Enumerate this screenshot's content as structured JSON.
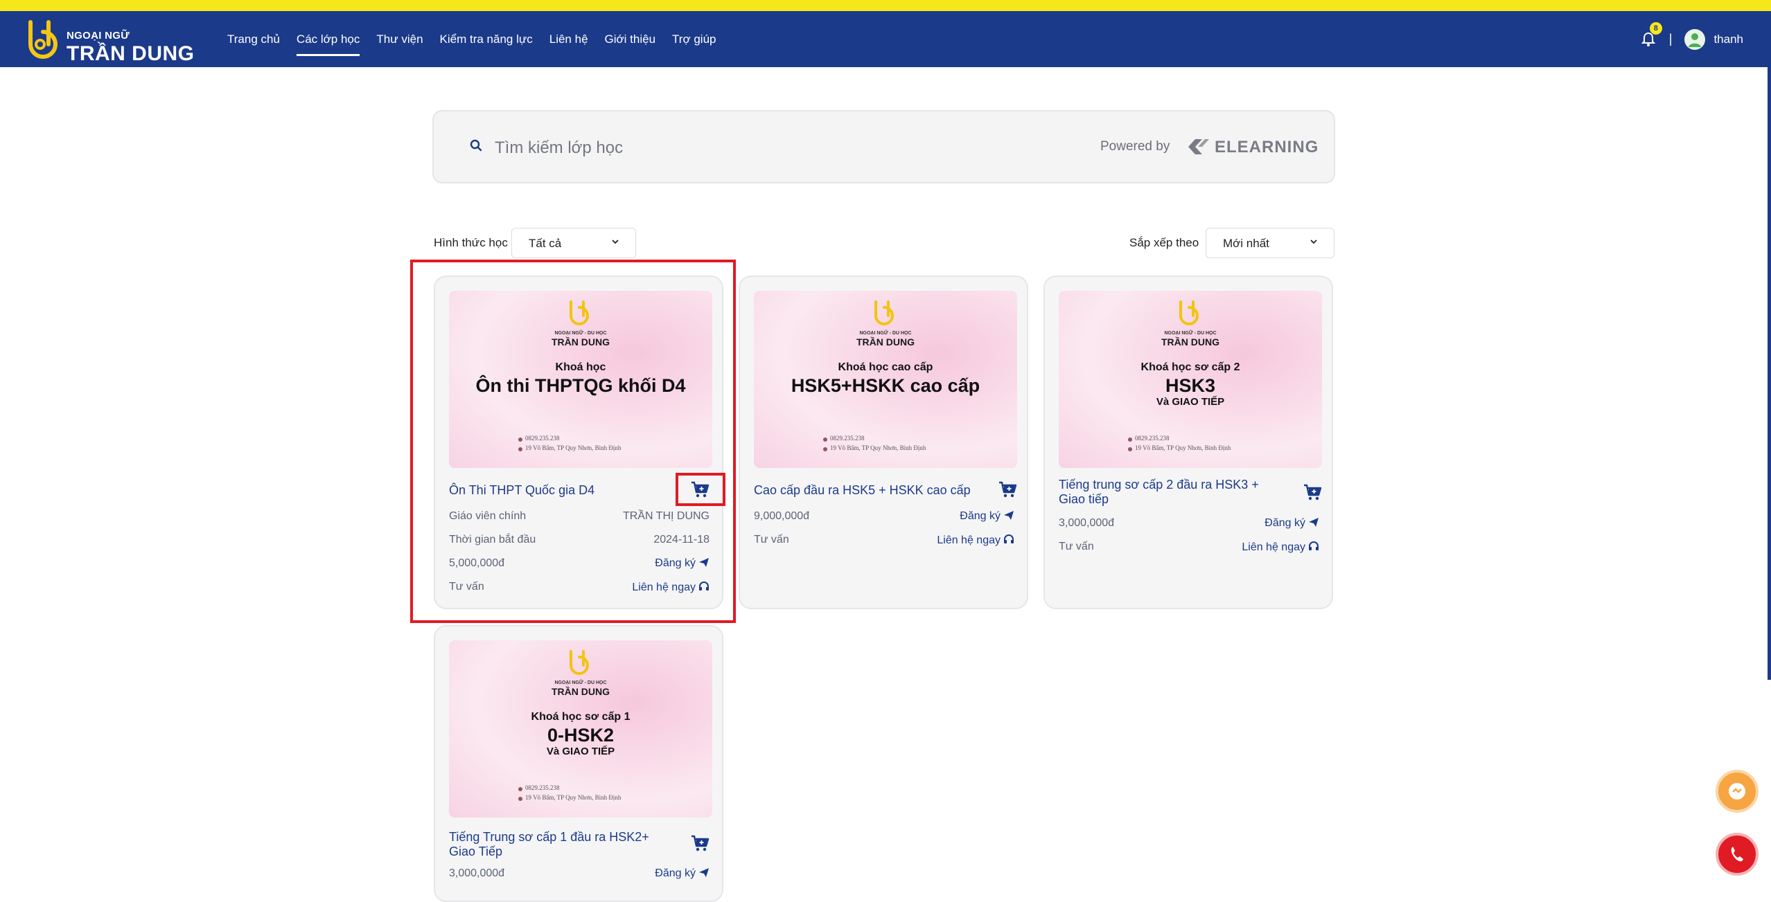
{
  "brand": {
    "small": "NGOẠI NGỮ",
    "big": "TRẦN DUNG"
  },
  "nav": [
    "Trang chủ",
    "Các lớp học",
    "Thư viện",
    "Kiểm tra năng lực",
    "Liên hệ",
    "Giới thiệu",
    "Trợ giúp"
  ],
  "nav_active": "Các lớp học",
  "notifications": {
    "count": "8"
  },
  "user": {
    "name": "thanh"
  },
  "search": {
    "placeholder": "Tìm kiếm lớp học",
    "powered_by": "Powered by",
    "provider": "ELEARNING"
  },
  "filters": {
    "mode_label": "Hình thức học",
    "mode_value": "Tất cả",
    "sort_label": "Sắp xếp theo",
    "sort_value": "Mới nhất"
  },
  "thumb_common": {
    "tagline": "NGOẠI NGỮ - DU HỌC",
    "brand": "TRẦN DUNG",
    "phone": "0829.235.238",
    "address": "19 Võ Bẩm, TP Quy Nhơn, Bình Định"
  },
  "courses": [
    {
      "thumb_kind": "Khoá học",
      "thumb_title": "Ôn thi THPTQG khối D4",
      "thumb_sub": "",
      "title": "Ôn Thi THPT Quốc gia D4",
      "teacher_label": "Giáo viên chính",
      "teacher": "TRẦN THỊ DUNG",
      "start_label": "Thời gian bắt đầu",
      "start": "2024-11-18",
      "price": "5,000,000đ",
      "register": "Đăng ký",
      "consult_label": "Tư vấn",
      "contact": "Liên hệ ngay"
    },
    {
      "thumb_kind": "Khoá học cao cấp",
      "thumb_title": "HSK5+HSKK cao cấp",
      "thumb_sub": "",
      "title": "Cao cấp đầu ra HSK5 + HSKK cao cấp",
      "price": "9,000,000đ",
      "register": "Đăng ký",
      "consult_label": "Tư vấn",
      "contact": "Liên hệ ngay"
    },
    {
      "thumb_kind": "Khoá học sơ cấp 2",
      "thumb_title": "HSK3",
      "thumb_sub": "Và GIAO TIẾP",
      "title": "Tiếng trung sơ cấp 2 đầu ra HSK3 + Giao tiếp",
      "price": "3,000,000đ",
      "register": "Đăng ký",
      "consult_label": "Tư vấn",
      "contact": "Liên hệ ngay"
    },
    {
      "thumb_kind": "Khoá học sơ cấp 1",
      "thumb_title": "0-HSK2",
      "thumb_sub": "Và GIAO TIẾP",
      "title": "Tiếng Trung sơ cấp 1 đầu ra HSK2+ Giao Tiếp",
      "price": "3,000,000đ",
      "register": "Đăng ký"
    }
  ],
  "colors": {
    "navbar": "#1b3a8a",
    "stripe": "#f6e71a",
    "accent": "#1b3a8a",
    "highlight": "#e01b24"
  },
  "icons": {
    "search": "search-icon",
    "cart": "cart-icon",
    "send": "send-icon",
    "headset": "headset-icon",
    "bell": "bell-icon",
    "chat": "chat-icon",
    "phone": "phone-icon"
  }
}
